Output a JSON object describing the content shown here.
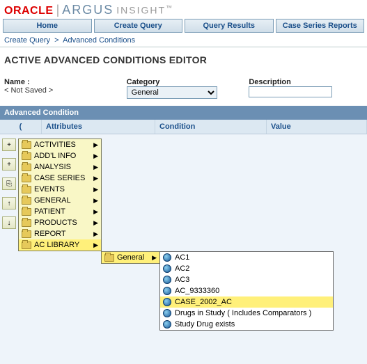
{
  "brand": {
    "oracle": "ORACLE",
    "argus": "ARGUS",
    "insight": "INSIGHT",
    "tm": "™"
  },
  "nav": {
    "home": "Home",
    "create": "Create Query",
    "results": "Query Results",
    "reports": "Case Series Reports"
  },
  "crumb": {
    "a": "Create Query",
    "sep": ">",
    "b": "Advanced Conditions"
  },
  "title": "ACTIVE ADVANCED CONDITIONS EDITOR",
  "form": {
    "name_label": "Name :",
    "name_value": "< Not Saved >",
    "category_label": "Category",
    "category_value": "General",
    "desc_label": "Description",
    "desc_value": ""
  },
  "panel": {
    "head": "Advanced Condition"
  },
  "cols": {
    "c1": "(",
    "c2": "Attributes",
    "c3": "Condition",
    "c4": "Value"
  },
  "tools": {
    "t1": "+",
    "t2": "+",
    "t3": "⎘",
    "t4": "↑",
    "t5": "↓"
  },
  "menu": {
    "items": [
      {
        "label": "ACTIVITIES"
      },
      {
        "label": "ADD'L INFO"
      },
      {
        "label": "ANALYSIS"
      },
      {
        "label": "CASE SERIES"
      },
      {
        "label": "EVENTS"
      },
      {
        "label": "GENERAL"
      },
      {
        "label": "PATIENT"
      },
      {
        "label": "PRODUCTS"
      },
      {
        "label": "REPORT"
      },
      {
        "label": "AC LIBRARY"
      }
    ]
  },
  "submenu": {
    "general": "General"
  },
  "leafs": {
    "items": [
      {
        "label": "AC1"
      },
      {
        "label": "AC2"
      },
      {
        "label": "AC3"
      },
      {
        "label": "AC_9333360"
      },
      {
        "label": "CASE_2002_AC"
      },
      {
        "label": "Drugs in Study ( Includes Comparators )"
      },
      {
        "label": "Study Drug exists"
      }
    ]
  }
}
